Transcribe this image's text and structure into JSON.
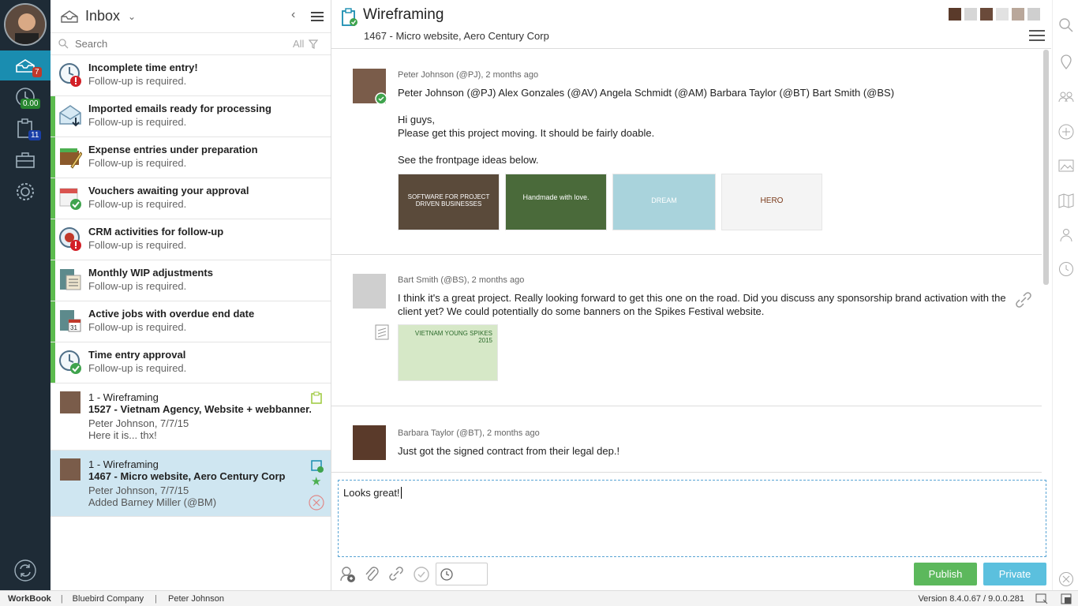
{
  "rail": {
    "inbox_count": "7",
    "time_value": "0.00",
    "tasks_count": "11"
  },
  "inbox": {
    "title": "Inbox",
    "search_placeholder": "Search",
    "filter_label": "All",
    "items": [
      {
        "title": "Incomplete time entry!",
        "sub": "Follow-up is required.",
        "icon": "clock-alert-icon"
      },
      {
        "title": "Imported emails ready for processing",
        "sub": "Follow-up is required.",
        "icon": "email-import-icon"
      },
      {
        "title": "Expense entries under preparation",
        "sub": "Follow-up is required.",
        "icon": "wallet-pen-icon"
      },
      {
        "title": "Vouchers awaiting your approval",
        "sub": "Follow-up is required.",
        "icon": "voucher-check-icon"
      },
      {
        "title": "CRM activities for follow-up",
        "sub": "Follow-up is required.",
        "icon": "crm-alert-icon"
      },
      {
        "title": "Monthly WIP adjustments",
        "sub": "Follow-up is required.",
        "icon": "ledger-icon"
      },
      {
        "title": "Active jobs with overdue end date",
        "sub": "Follow-up is required.",
        "icon": "calendar-31-icon"
      },
      {
        "title": "Time entry approval",
        "sub": "Follow-up is required.",
        "icon": "clock-check-icon"
      }
    ],
    "messages": [
      {
        "line1": "1 - Wireframing",
        "line2": "1527 - Vietnam Agency, Website + webbanner...",
        "line3": "Peter Johnson, 7/7/15",
        "line4": "Here it is... thx!"
      },
      {
        "line1": "1 - Wireframing",
        "line2": "1467 - Micro website, Aero Century Corp",
        "line3": "Peter Johnson, 7/7/15",
        "line4": "Added Barney Miller (@BM)"
      }
    ]
  },
  "main": {
    "title": "Wireframing",
    "subtitle": "1467 - Micro website, Aero Century Corp",
    "posts": [
      {
        "meta": "Peter Johnson (@PJ), 2 months ago",
        "mentions": "Peter Johnson (@PJ) Alex Gonzales (@AV) Angela Schmidt (@AM) Barbara Taylor (@BT) Bart Smith (@BS)",
        "greeting": "Hi guys,",
        "line": "Please get this project moving. It should be fairly doable.",
        "line2": "See the frontpage ideas below.",
        "thumbs": [
          "SOFTWARE FOR PROJECT DRIVEN BUSINESSES",
          "Handmade with love.",
          "DREAM",
          "HERO"
        ]
      },
      {
        "meta": "Bart Smith (@BS), 2 months ago",
        "text": "I think it's a great project. Really looking forward to get this one on the road. Did you discuss any sponsorship brand activation with the client yet? We could potentially do some banners on the Spikes Festival website.",
        "thumb_text": "VIETNAM YOUNG SPIKES 2015"
      },
      {
        "meta": "Barbara Taylor (@BT), 2 months ago",
        "text": "Just got the signed contract from their legal dep.!"
      }
    ],
    "compose_text": "Looks great!",
    "publish_label": "Publish",
    "private_label": "Private"
  },
  "status": {
    "app": "WorkBook",
    "company": "Bluebird Company",
    "user": "Peter Johnson",
    "version": "Version 8.4.0.67 / 9.0.0.281"
  },
  "colors": {
    "rail_bg": "#1e2b36",
    "accent": "#1a8db0",
    "green": "#5cbb4e",
    "publish": "#5cb85c",
    "private": "#5bc0de"
  }
}
